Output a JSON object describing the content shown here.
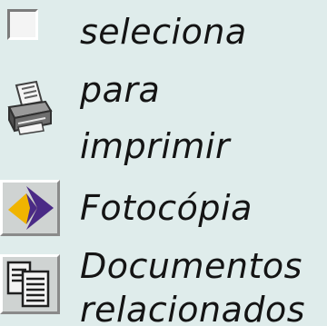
{
  "items": [
    {
      "label": "seleciona",
      "icon": "checkbox-icon"
    },
    {
      "label_line1": "para",
      "label_line2": "imprimir",
      "icon": "printer-icon"
    },
    {
      "label": "Fotocópia",
      "icon": "photocopy-icon"
    },
    {
      "label_line1": "Documentos",
      "label_line2": "relacionados",
      "icon": "documents-icon"
    }
  ],
  "colors": {
    "background": "#dfeceb",
    "text": "#141414",
    "photocopy_purple": "#4a2a86",
    "photocopy_yellow": "#f0b400"
  }
}
